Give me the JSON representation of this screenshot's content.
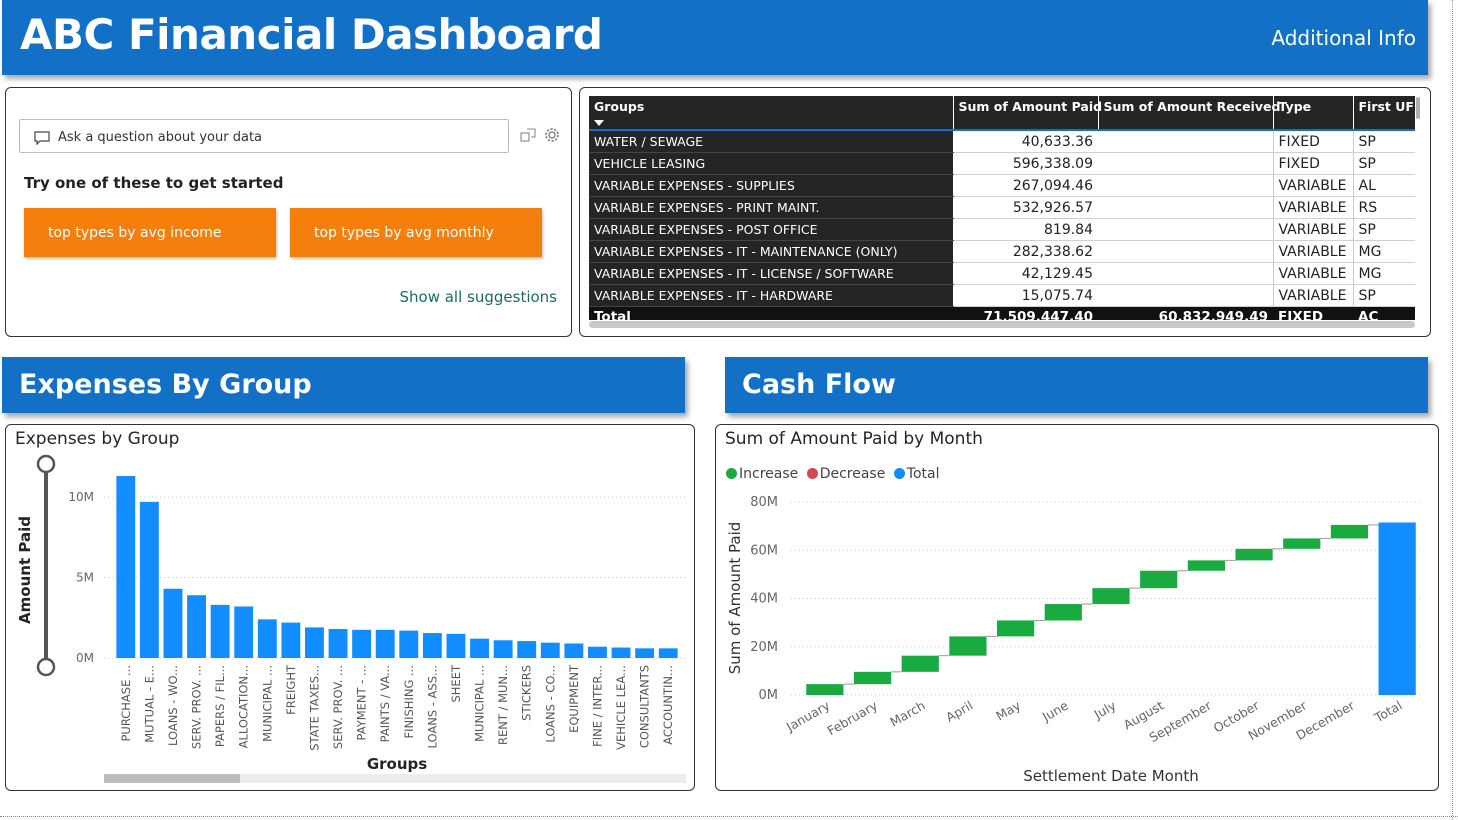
{
  "header": {
    "title": "ABC Financial Dashboard",
    "info_label": "Additional Info"
  },
  "qa": {
    "placeholder": "Ask a question about your data",
    "prompt": "Try one of these to get started",
    "suggestions": [
      "top types by avg income",
      "top types by avg monthly"
    ],
    "show_all": "Show all suggestions"
  },
  "table": {
    "columns": [
      "Groups",
      "Sum of Amount Paid",
      "Sum of Amount Received",
      "Type",
      "First UF"
    ],
    "rows": [
      {
        "group": "WATER / SEWAGE",
        "paid": "40,633.36",
        "received": "",
        "type": "FIXED",
        "uf": "SP"
      },
      {
        "group": "VEHICLE LEASING",
        "paid": "596,338.09",
        "received": "",
        "type": "FIXED",
        "uf": "SP"
      },
      {
        "group": "VARIABLE EXPENSES - SUPPLIES",
        "paid": "267,094.46",
        "received": "",
        "type": "VARIABLE",
        "uf": "AL"
      },
      {
        "group": "VARIABLE EXPENSES - PRINT MAINT.",
        "paid": "532,926.57",
        "received": "",
        "type": "VARIABLE",
        "uf": "RS"
      },
      {
        "group": "VARIABLE EXPENSES - POST OFFICE",
        "paid": "819.84",
        "received": "",
        "type": "VARIABLE",
        "uf": "SP"
      },
      {
        "group": "VARIABLE EXPENSES - IT - MAINTENANCE (ONLY)",
        "paid": "282,338.62",
        "received": "",
        "type": "VARIABLE",
        "uf": "MG"
      },
      {
        "group": "VARIABLE EXPENSES - IT - LICENSE / SOFTWARE",
        "paid": "42,129.45",
        "received": "",
        "type": "VARIABLE",
        "uf": "MG"
      },
      {
        "group": "VARIABLE EXPENSES - IT - HARDWARE",
        "paid": "15,075.74",
        "received": "",
        "type": "VARIABLE",
        "uf": "SP"
      }
    ],
    "total": {
      "label": "Total",
      "paid": "71,509,447.40",
      "received": "60,832,949.49",
      "type": "FIXED",
      "uf": "AC"
    }
  },
  "sections": {
    "expenses": "Expenses By Group",
    "cash": "Cash Flow"
  },
  "colors": {
    "banner": "#1270c7",
    "suggestion": "#f57f0d",
    "bar": "#118dff",
    "increase": "#1aab40",
    "decrease": "#d64550",
    "total": "#118dff"
  },
  "chart_data": [
    {
      "type": "bar",
      "title": "Expenses by Group",
      "xlabel": "Groups",
      "ylabel": "Amount Paid",
      "ylim": [
        0,
        12000000
      ],
      "yticks": [
        "0M",
        "5M",
        "10M"
      ],
      "categories": [
        "PURCHASE ...",
        "MUTUAL - E...",
        "LOANS - WO...",
        "SERV. PROV. ...",
        "PAPERS / FIL...",
        "ALLOCATION...",
        "MUNICIPAL ...",
        "FREIGHT",
        "STATE TAXES...",
        "SERV. PROV. ...",
        "PAYMENT - ...",
        "PAINTS / VA...",
        "FINISHING ...",
        "LOANS - ASS...",
        "SHEET",
        "MUNICIPAL ...",
        "RENT / MUN...",
        "STICKERS",
        "LOANS - CO...",
        "EQUIPMENT",
        "FINE / INTER...",
        "VEHICLE LEA...",
        "CONSULTANTS",
        "ACCOUNTIN..."
      ],
      "values": [
        11300000,
        9700000,
        4300000,
        3900000,
        3300000,
        3200000,
        2400000,
        2200000,
        1900000,
        1800000,
        1750000,
        1750000,
        1700000,
        1550000,
        1500000,
        1200000,
        1100000,
        1050000,
        950000,
        900000,
        700000,
        650000,
        600000,
        600000
      ],
      "grid": true
    },
    {
      "type": "waterfall",
      "title": "Sum of Amount Paid by Month",
      "xlabel": "Settlement Date Month",
      "ylabel": "Sum of Amount Paid",
      "ylim": [
        0,
        80000000
      ],
      "yticks": [
        "0M",
        "20M",
        "40M",
        "60M",
        "80M"
      ],
      "legend": {
        "position": "top-left",
        "entries": [
          "Increase",
          "Decrease",
          "Total"
        ]
      },
      "categories": [
        "January",
        "February",
        "March",
        "April",
        "May",
        "June",
        "July",
        "August",
        "September",
        "October",
        "November",
        "December",
        "Total"
      ],
      "steps": [
        4500000,
        5100000,
        6700000,
        8000000,
        6600000,
        6800000,
        6600000,
        7200000,
        4300000,
        4800000,
        4300000,
        5600000
      ],
      "total": 71509447.4,
      "grid": true
    }
  ]
}
